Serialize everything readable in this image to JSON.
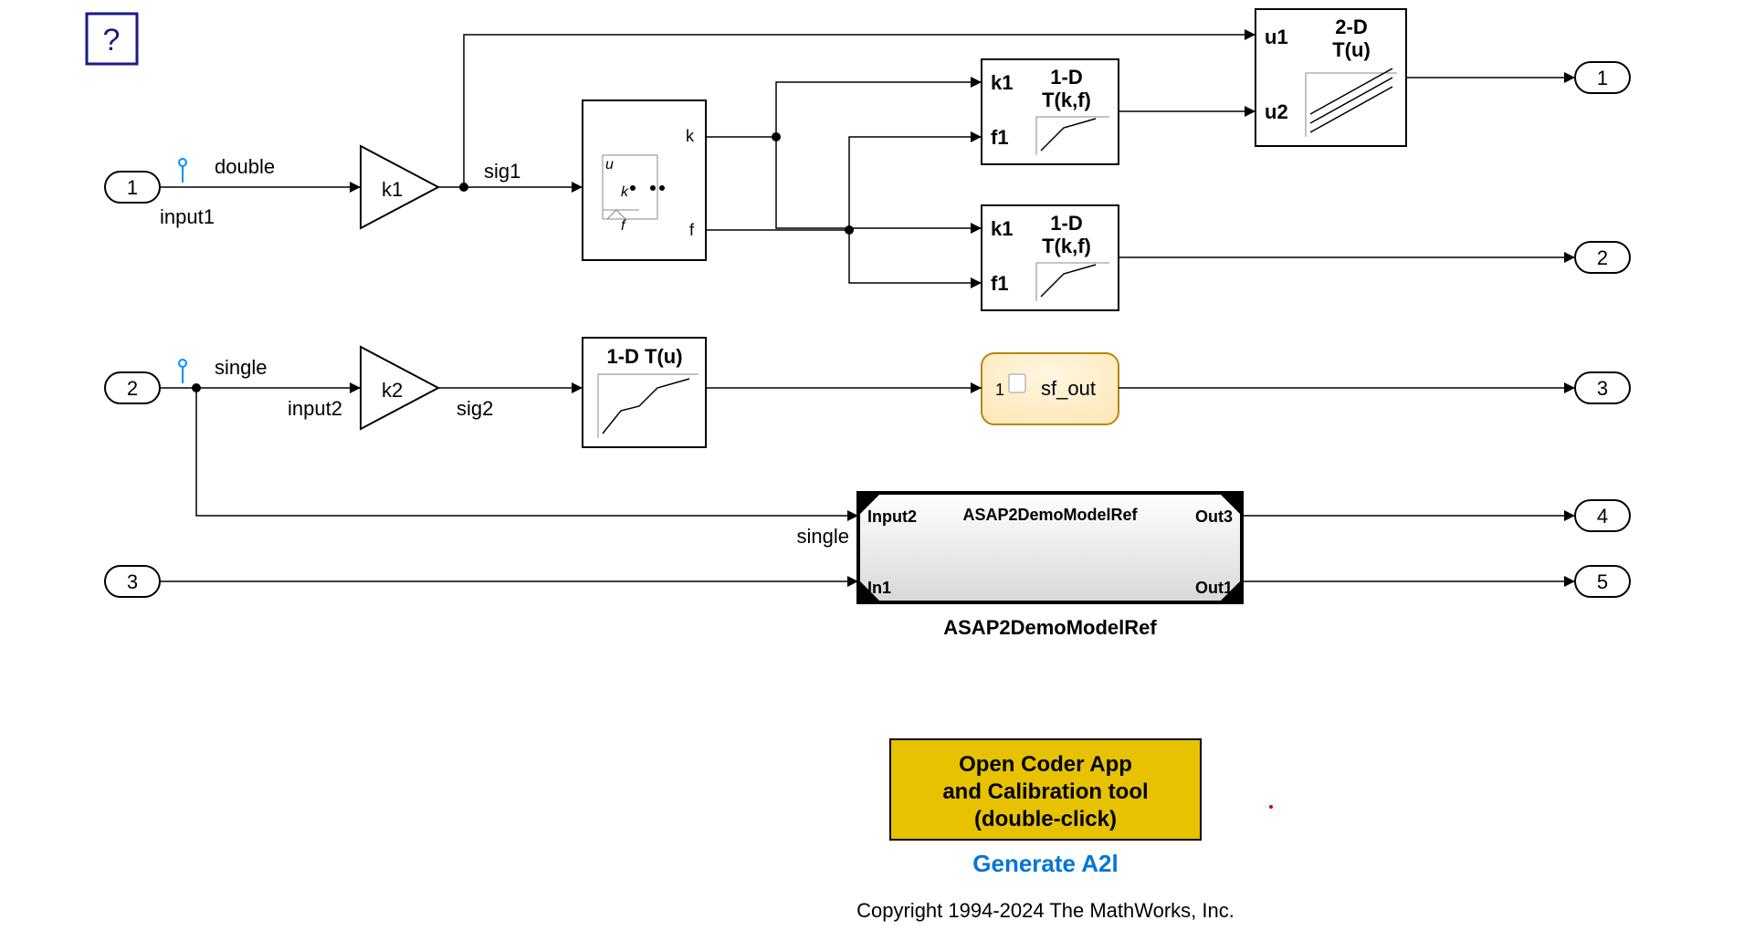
{
  "help": "?",
  "inports": {
    "p1": "1",
    "p1_label": "input1",
    "p1_type": "double",
    "p2": "2",
    "p2_label": "input2",
    "p2_type": "single",
    "p3": "3"
  },
  "outports": {
    "o1": "1",
    "o2": "2",
    "o3": "3",
    "o4": "4",
    "o5": "5"
  },
  "gains": {
    "g1": "k1",
    "g1_out": "sig1",
    "g2": "k2",
    "g2_out": "sig2"
  },
  "prelookup": {
    "u": "u",
    "k": "k",
    "f": "f",
    "out_k": "k",
    "out_f": "f"
  },
  "lookup1d_a": {
    "k": "k1",
    "f": "f1",
    "title": "1-D",
    "sub": "T(k,f)"
  },
  "lookup1d_b": {
    "k": "k1",
    "f": "f1",
    "title": "1-D",
    "sub": "T(k,f)"
  },
  "lookup2d": {
    "u1": "u1",
    "u2": "u2",
    "title": "2-D",
    "sub": "T(u)"
  },
  "lookup1d_simple": {
    "title": "1-D T(u)"
  },
  "stateflow": {
    "in": "1",
    "out": "sf_out"
  },
  "modelref": {
    "in1": "Input2",
    "in1_type": "single",
    "in2": "In1",
    "out1": "Out3",
    "out2": "Out1",
    "name": "ASAP2DemoModelRef",
    "label": "ASAP2DemoModelRef"
  },
  "yellowbox": {
    "l1": "Open Coder App",
    "l2": "and Calibration tool",
    "l3": "(double-click)"
  },
  "generate": "Generate A2l",
  "copyright": "Copyright 1994-2024 The MathWorks, Inc."
}
